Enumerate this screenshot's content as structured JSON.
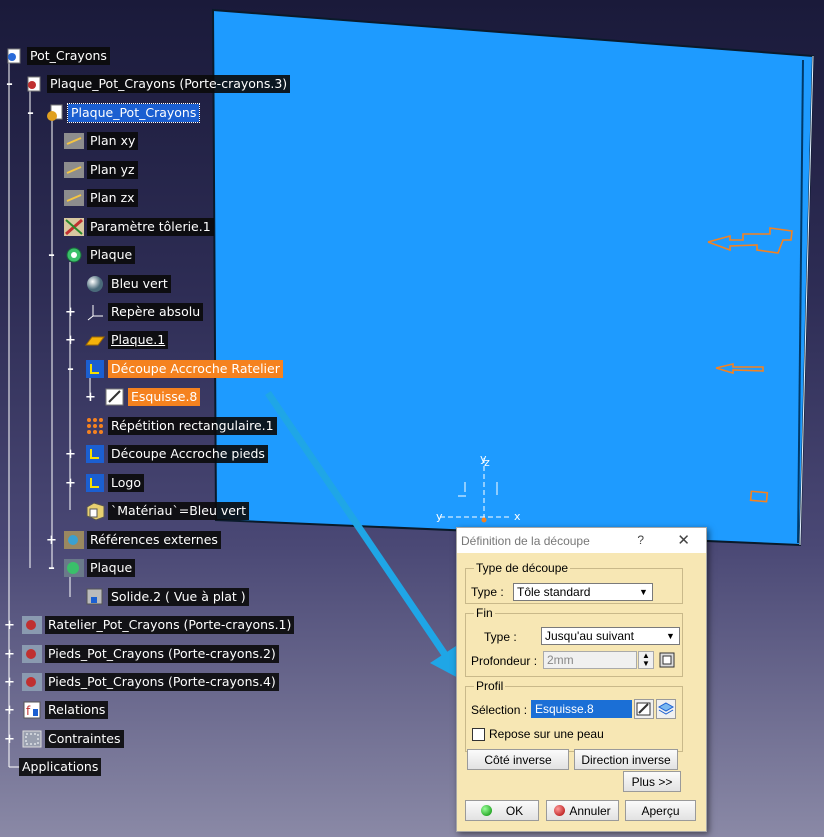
{
  "tree": {
    "root": "Pot_Crayons",
    "nodes": [
      {
        "label": "Plaque_Pot_Crayons (Porte-crayons.3)"
      },
      {
        "label": "Plaque_Pot_Crayons"
      },
      {
        "label": "Plan xy"
      },
      {
        "label": "Plan yz"
      },
      {
        "label": "Plan zx"
      },
      {
        "label": "Paramètre tôlerie.1"
      },
      {
        "label": "Plaque"
      },
      {
        "label": "Bleu vert"
      },
      {
        "label": "Repère absolu"
      },
      {
        "label": "Plaque.1"
      },
      {
        "label": "Découpe Accroche Ratelier"
      },
      {
        "label": "Esquisse.8"
      },
      {
        "label": "Répétition rectangulaire.1"
      },
      {
        "label": "Découpe Accroche pieds"
      },
      {
        "label": "Logo"
      },
      {
        "label": "`Matériau`=Bleu vert"
      },
      {
        "label": "Références externes"
      },
      {
        "label": "Plaque"
      },
      {
        "label": "Solide.2 ( Vue à plat )"
      },
      {
        "label": "Ratelier_Pot_Crayons (Porte-crayons.1)"
      },
      {
        "label": "Pieds_Pot_Crayons (Porte-crayons.2)"
      },
      {
        "label": "Pieds_Pot_Crayons (Porte-crayons.4)"
      },
      {
        "label": "Relations"
      },
      {
        "label": "Contraintes"
      },
      {
        "label": "Applications"
      }
    ]
  },
  "viewport": {
    "axes": {
      "x": "x",
      "y": "y",
      "z": "z"
    },
    "colors": {
      "plate": "#1e9bff",
      "sketch": "#f5821f",
      "arrow": "#1fa6e6"
    }
  },
  "dialog": {
    "title": "Définition de la découpe",
    "help": "?",
    "close": "✕",
    "type_group": {
      "title": "Type de découpe",
      "type_label": "Type :",
      "type_value": "Tôle standard"
    },
    "end_group": {
      "title": "Fin",
      "type_label": "Type :",
      "type_value": "Jusqu'au suivant",
      "depth_label": "Profondeur :",
      "depth_value": "2mm"
    },
    "profile_group": {
      "title": "Profil",
      "selection_label": "Sélection :",
      "selection_value": "Esquisse.8",
      "checkbox_label": "Repose sur une peau",
      "checkbox_checked": false
    },
    "buttons": {
      "reverse_side": "Côté inverse",
      "reverse_direction": "Direction inverse",
      "more": "Plus >>",
      "ok": "OK",
      "cancel": "Annuler",
      "preview": "Aperçu"
    }
  }
}
